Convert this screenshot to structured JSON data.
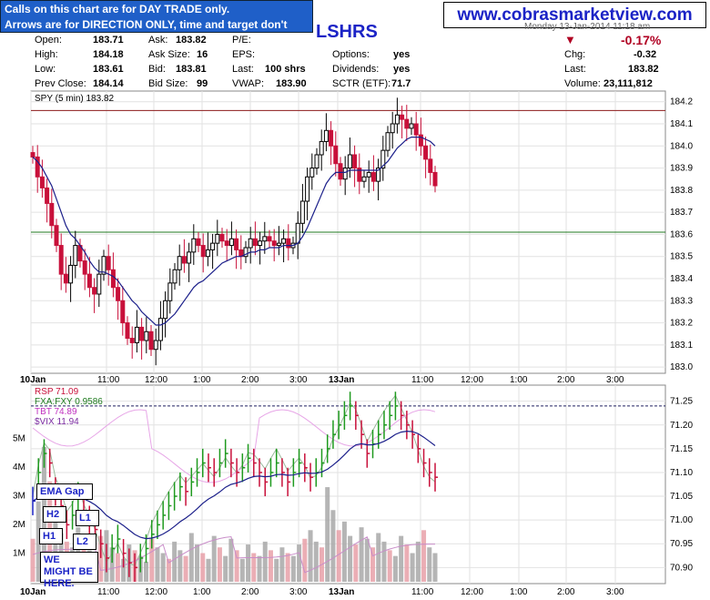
{
  "notice": {
    "line1": "Calls on this chart are for DAY TRADE only.",
    "line2": "Arrows are for DIRECTION ONLY, time and target don't count."
  },
  "site": "www.cobrasmarketview.com",
  "symbol": "LSHRS",
  "date_text": "Monday 13-Jan-2014 11:18 am",
  "quote": {
    "open_label": "Open:",
    "open": "183.71",
    "high_label": "High:",
    "high": "184.18",
    "low_label": "Low:",
    "low": "183.61",
    "prev_label": "Prev Close:",
    "prev": "184.14",
    "ask_label": "Ask:",
    "ask": "183.82",
    "asksize_label": "Ask Size:",
    "asksize": "16",
    "bid_label": "Bid:",
    "bid": "183.81",
    "bidsize_label": "Bid Size:",
    "bidsize": "99",
    "pe_label": "P/E:",
    "pe": "",
    "eps_label": "EPS:",
    "eps": "",
    "last_label": "Last:",
    "last_shares": "100 shrs",
    "vwap_label": "VWAP:",
    "vwap": "183.90",
    "options_label": "Options:",
    "options": "yes",
    "dividends_label": "Dividends:",
    "dividends": "yes",
    "sctr_label": "SCTR (ETF):",
    "sctr": "71.7",
    "pct_change": "-0.17%",
    "chg_label": "Chg:",
    "chg": "-0.32",
    "last2_label": "Last:",
    "last2": "183.82",
    "volume_label": "Volume:",
    "volume": "23,111,812"
  },
  "colors": {
    "up": "#000000",
    "down": "#c8103a",
    "ema": "#1b1f8a",
    "upper_line": "#8b1a1a",
    "lower_line": "#1f7a1f",
    "rsp_up": "#1e9a1e",
    "rsp_down": "#c8103a",
    "rsp_blue": "#1b23c6",
    "fxa": "#9bb89b",
    "tbt": "#e7a6e7",
    "vol_gray": "#a8a8a8",
    "vol_red": "#e8a0a8"
  },
  "annotations": {
    "ema_gap": "EMA Gap",
    "h2": "H2",
    "l1": "L1",
    "h1": "H1",
    "l2": "L2",
    "might": "WE MIGHT BE HERE."
  },
  "chart_data": [
    {
      "type": "candlestick",
      "title": "SPY (5 min) 183.82",
      "x_ticks": [
        "10Jan",
        "11:00",
        "12:00",
        "1:00",
        "2:00",
        "3:00",
        "13Jan",
        "11:00",
        "12:00",
        "1:00",
        "2:00",
        "3:00"
      ],
      "y_ticks": [
        184.2,
        184.1,
        184.0,
        183.9,
        183.8,
        183.7,
        183.6,
        183.5,
        183.4,
        183.3,
        183.2,
        183.1,
        183.0
      ],
      "ylim": [
        182.98,
        184.24
      ],
      "reference_lines": [
        184.16,
        183.61
      ],
      "closes": [
        183.95,
        183.86,
        183.81,
        183.74,
        183.64,
        183.55,
        183.42,
        183.38,
        183.46,
        183.55,
        183.48,
        183.42,
        183.36,
        183.33,
        183.42,
        183.5,
        183.44,
        183.36,
        183.3,
        183.2,
        183.13,
        183.11,
        183.18,
        183.12,
        183.16,
        183.08,
        183.12,
        183.22,
        183.3,
        183.38,
        183.44,
        183.5,
        183.47,
        183.52,
        183.58,
        183.55,
        183.5,
        183.53,
        183.56,
        183.6,
        183.57,
        183.55,
        183.58,
        183.53,
        183.5,
        183.54,
        183.58,
        183.55,
        183.57,
        183.59,
        183.57,
        183.55,
        183.56,
        183.58,
        183.54,
        183.56,
        183.65,
        183.75,
        183.86,
        183.9,
        183.96,
        184.02,
        184.07,
        184.0,
        183.92,
        183.85,
        183.9,
        183.96,
        183.9,
        183.84,
        183.86,
        183.88,
        183.84,
        183.9,
        183.98,
        184.06,
        184.1,
        184.14,
        184.12,
        184.08,
        184.1,
        184.05,
        184.0,
        183.94,
        183.88,
        183.82
      ],
      "ema": [
        183.95,
        183.93,
        183.9,
        183.86,
        183.82,
        183.76,
        183.7,
        183.64,
        183.6,
        183.58,
        183.55,
        183.52,
        183.48,
        183.45,
        183.43,
        183.43,
        183.42,
        183.41,
        183.39,
        183.36,
        183.33,
        183.3,
        183.28,
        183.25,
        183.23,
        183.21,
        183.19,
        183.19,
        183.2,
        183.22,
        183.24,
        183.27,
        183.3,
        183.33,
        183.36,
        183.38,
        183.39,
        183.41,
        183.43,
        183.45,
        183.47,
        183.48,
        183.49,
        183.5,
        183.5,
        183.51,
        183.52,
        183.52,
        183.53,
        183.53,
        183.54,
        183.54,
        183.54,
        183.55,
        183.55,
        183.55,
        183.56,
        183.59,
        183.63,
        183.68,
        183.73,
        183.78,
        183.83,
        183.86,
        183.88,
        183.88,
        183.88,
        183.89,
        183.89,
        183.89,
        183.89,
        183.89,
        183.89,
        183.89,
        183.91,
        183.93,
        183.96,
        183.99,
        184.01,
        184.03,
        184.04,
        184.04,
        184.04,
        184.03,
        184.02,
        184.0
      ]
    },
    {
      "type": "line",
      "title": "RSP 71.09",
      "series_names": [
        "RSP 71.09",
        "FXA:FXY 0.9586",
        "TBT 74.89",
        "$VIX 11.94"
      ],
      "y_ticks": [
        71.25,
        71.2,
        71.15,
        71.1,
        71.05,
        71.0,
        70.95,
        70.9
      ],
      "left_ticks": [
        "5M",
        "4M",
        "3M",
        "2M",
        "1M"
      ],
      "ylim": [
        70.87,
        71.28
      ],
      "reference_lines": [
        71.24
      ],
      "closes": [
        71.04,
        71.1,
        71.14,
        71.12,
        71.06,
        71.03,
        70.99,
        71.01,
        71.05,
        71.02,
        71.0,
        70.98,
        70.95,
        70.92,
        70.94,
        70.96,
        70.93,
        70.91,
        70.9,
        70.92,
        70.94,
        70.97,
        70.99,
        71.01,
        71.03,
        71.05,
        71.07,
        71.06,
        71.08,
        71.1,
        71.12,
        71.11,
        71.1,
        71.12,
        71.14,
        71.12,
        71.1,
        71.11,
        71.13,
        71.12,
        71.1,
        71.08,
        71.1,
        71.12,
        71.1,
        71.08,
        71.1,
        71.12,
        71.11,
        71.09,
        71.1,
        71.12,
        71.15,
        71.18,
        71.2,
        71.22,
        71.24,
        71.22,
        71.18,
        71.14,
        71.16,
        71.18,
        71.2,
        71.22,
        71.24,
        71.22,
        71.2,
        71.18,
        71.15,
        71.12,
        71.1,
        71.09
      ],
      "volume_millions": [
        1.5,
        2.8,
        4.7,
        3.5,
        2.1,
        1.7,
        1.4,
        1.2,
        1.9,
        1.3,
        1.1,
        0.9,
        1.6,
        1.8,
        1.2,
        1.0,
        0.8,
        1.3,
        1.1,
        0.9,
        0.7,
        1.5,
        1.2,
        1.0,
        0.8,
        1.4,
        1.1,
        0.9,
        1.7,
        1.3,
        1.0,
        0.8,
        1.6,
        1.2,
        0.9,
        1.5,
        1.1,
        0.8,
        1.3,
        1.0,
        0.9,
        1.4,
        1.1,
        0.8,
        1.2,
        1.0,
        0.9,
        1.3,
        1.5,
        1.8,
        1.4,
        1.2,
        3.3,
        2.5,
        1.8,
        2.1,
        1.6,
        1.3,
        1.9,
        1.5,
        1.2,
        1.7,
        1.4,
        1.1,
        0.9,
        1.6,
        1.3,
        1.0,
        1.4,
        1.8,
        1.2,
        1.0
      ]
    }
  ]
}
